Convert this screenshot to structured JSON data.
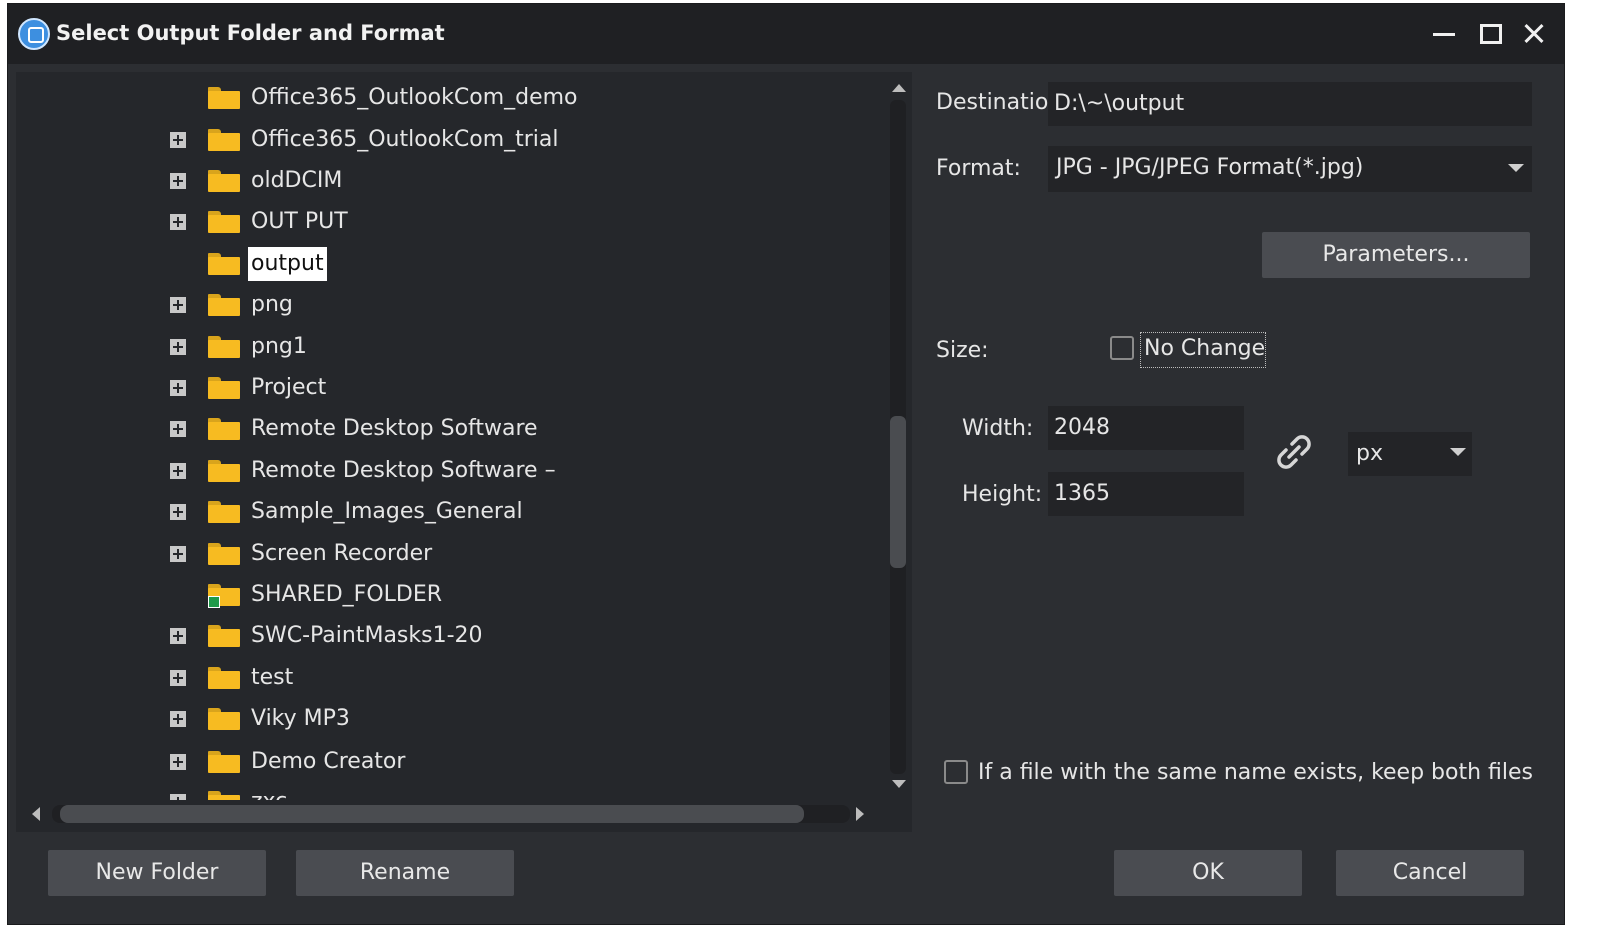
{
  "window": {
    "title": "Select Output Folder and Format",
    "icons": {
      "app": "app-logo-icon",
      "minimize": "minimize-icon",
      "maximize": "maximize-icon",
      "close": "close-icon"
    }
  },
  "tree": {
    "items": [
      {
        "label": "Office365_OutlookCom_demo",
        "expandable": false
      },
      {
        "label": "Office365_OutlookCom_trial",
        "expandable": true
      },
      {
        "label": "oldDCIM",
        "expandable": true
      },
      {
        "label": "OUT PUT",
        "expandable": true
      },
      {
        "label": "output",
        "expandable": false,
        "selected": true
      },
      {
        "label": "png",
        "expandable": true
      },
      {
        "label": "png1",
        "expandable": true
      },
      {
        "label": "Project",
        "expandable": true
      },
      {
        "label": "Remote Desktop Software",
        "expandable": true
      },
      {
        "label": "Remote Desktop Software –",
        "expandable": true
      },
      {
        "label": "Sample_Images_General",
        "expandable": true
      },
      {
        "label": "Screen Recorder",
        "expandable": true
      },
      {
        "label": "SHARED_FOLDER",
        "expandable": false,
        "shared": true
      },
      {
        "label": "SWC-PaintMasks1-20",
        "expandable": true
      },
      {
        "label": "test",
        "expandable": true
      },
      {
        "label": "Viky MP3",
        "expandable": true
      },
      {
        "label": "Demo Creator",
        "expandable": true
      },
      {
        "label": "zxc",
        "expandable": true
      }
    ]
  },
  "settings": {
    "destination_label": "Destinatio",
    "destination_value": "D:\\~\\output",
    "format_label": "Format:",
    "format_value": "JPG - JPG/JPEG Format(*.jpg)",
    "parameters_button": "Parameters...",
    "size_label": "Size:",
    "no_change_label": "No Change",
    "width_label": "Width:",
    "width_value": "2048",
    "height_label": "Height:",
    "height_value": "1365",
    "unit_value": "px",
    "keep_both_label": "If a file with the same name exists, keep both files"
  },
  "buttons": {
    "new_folder": "New Folder",
    "rename": "Rename",
    "ok": "OK",
    "cancel": "Cancel"
  },
  "colors": {
    "background": "#2c2e32",
    "titlebar": "#1f2023",
    "folder": "#f7bb21",
    "button": "#4a4c51"
  }
}
